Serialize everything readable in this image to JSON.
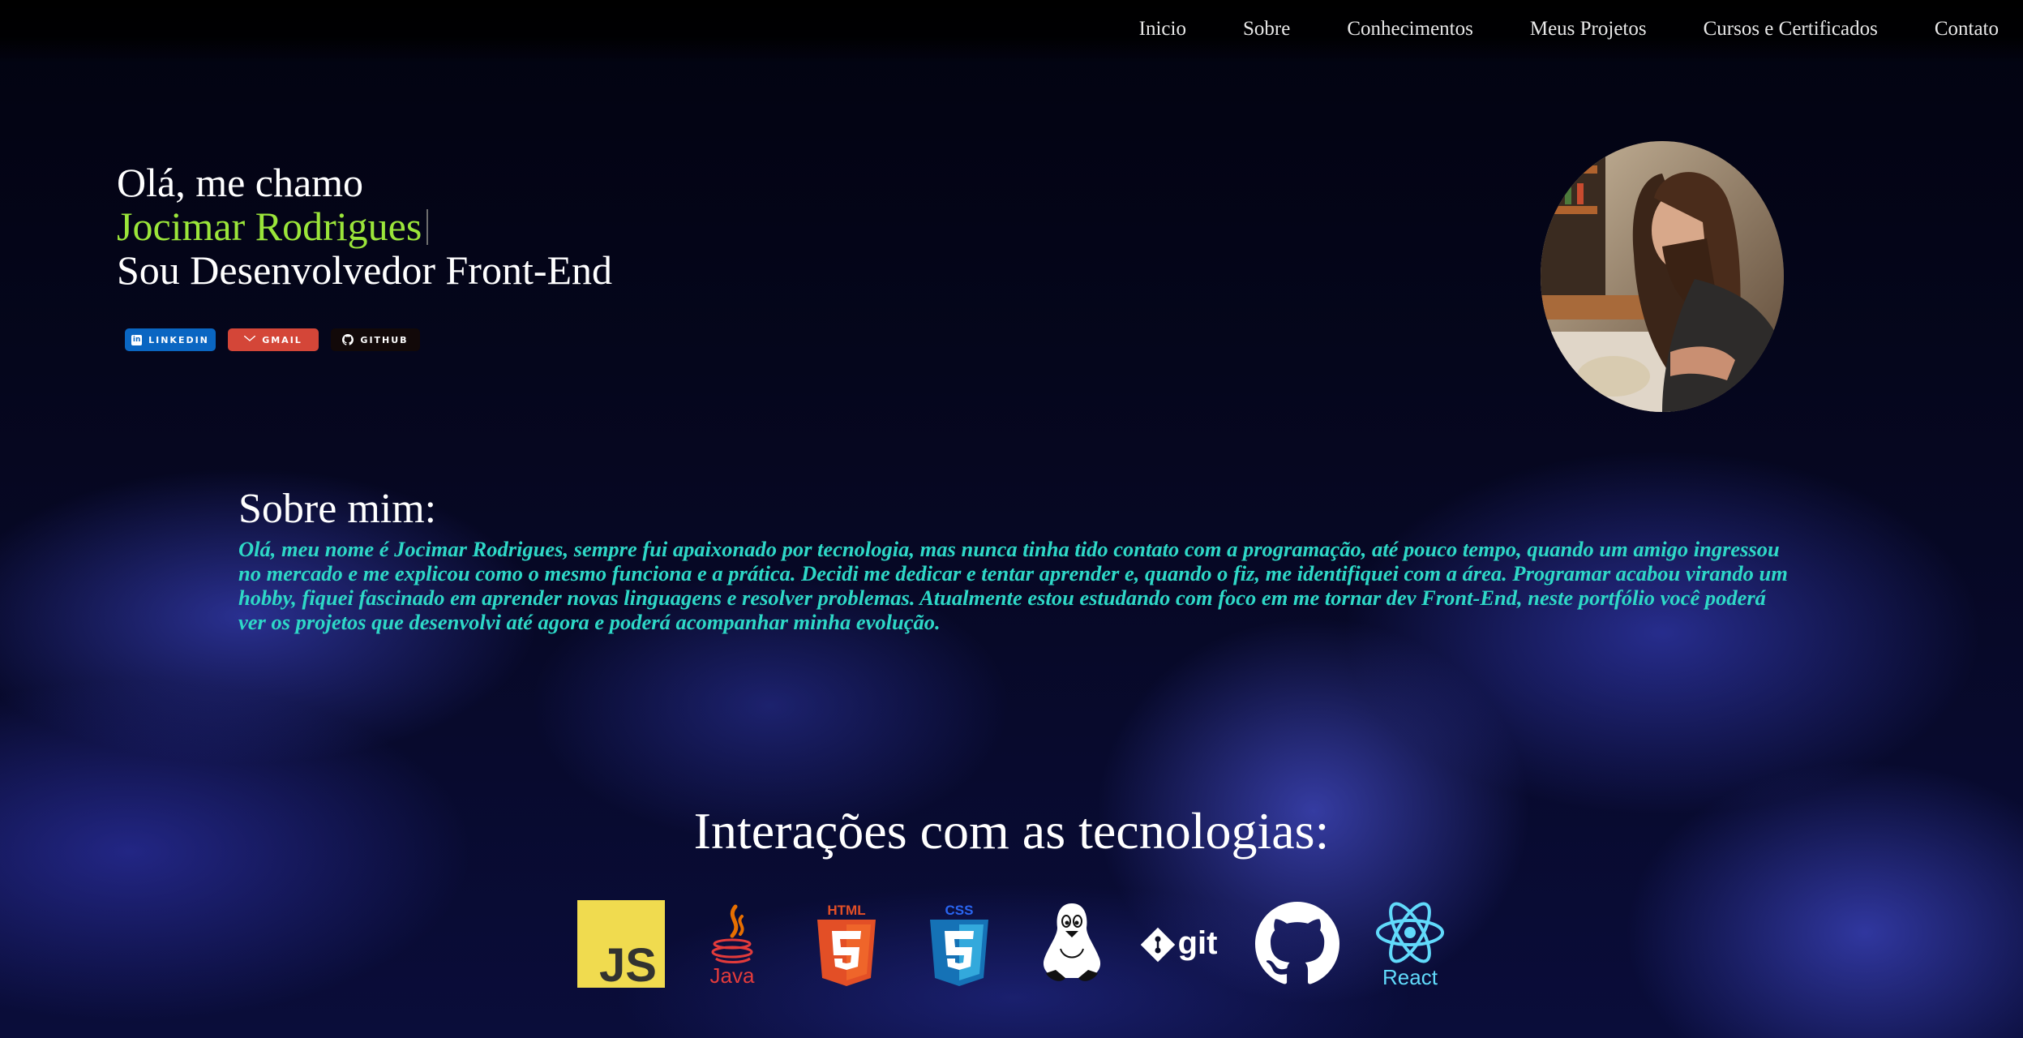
{
  "nav": {
    "items": [
      {
        "label": "Inicio"
      },
      {
        "label": "Sobre"
      },
      {
        "label": "Conhecimentos"
      },
      {
        "label": "Meus Projetos"
      },
      {
        "label": "Cursos e Certificados"
      },
      {
        "label": "Contato"
      }
    ]
  },
  "hero": {
    "greeting": "Olá, me chamo",
    "name": "Jocimar Rodrigues",
    "role": "Sou Desenvolvedor Front-End",
    "name_color": "#9be53a"
  },
  "social": {
    "linkedin": "LINKEDIN",
    "gmail": "GMAIL",
    "github": "GITHUB",
    "linkedin_color": "#0a66c2",
    "gmail_color": "#d44638",
    "github_color": "#120909"
  },
  "about": {
    "title": "Sobre mim:",
    "text": "Olá, meu nome é Jocimar Rodrigues, sempre fui apaixonado por tecnologia, mas nunca tinha tido contato com a programação, até pouco tempo, quando um amigo ingressou no mercado e me explicou como o mesmo funciona e a prática. Decidi me dedicar e tentar aprender e, quando o fiz, me identifiquei com a área. Programar acabou virando um hobby, fiquei fascinado em aprender novas linguagens e resolver problemas. Atualmente estou estudando com foco em me tornar dev Front-End, neste portfólio você poderá ver os projetos que desenvolvi até agora e poderá acompanhar minha evolução.",
    "text_color": "#2ed8c7"
  },
  "tech": {
    "title": "Interações com as tecnologias:",
    "js_label": "JS",
    "java_label": "Java",
    "html_label": "HTML",
    "css_label": "CSS",
    "git_label": "git",
    "react_label": "React",
    "icons": [
      "javascript-icon",
      "java-icon",
      "html5-icon",
      "css3-icon",
      "linux-tux-icon",
      "git-icon",
      "github-icon",
      "react-icon"
    ]
  }
}
